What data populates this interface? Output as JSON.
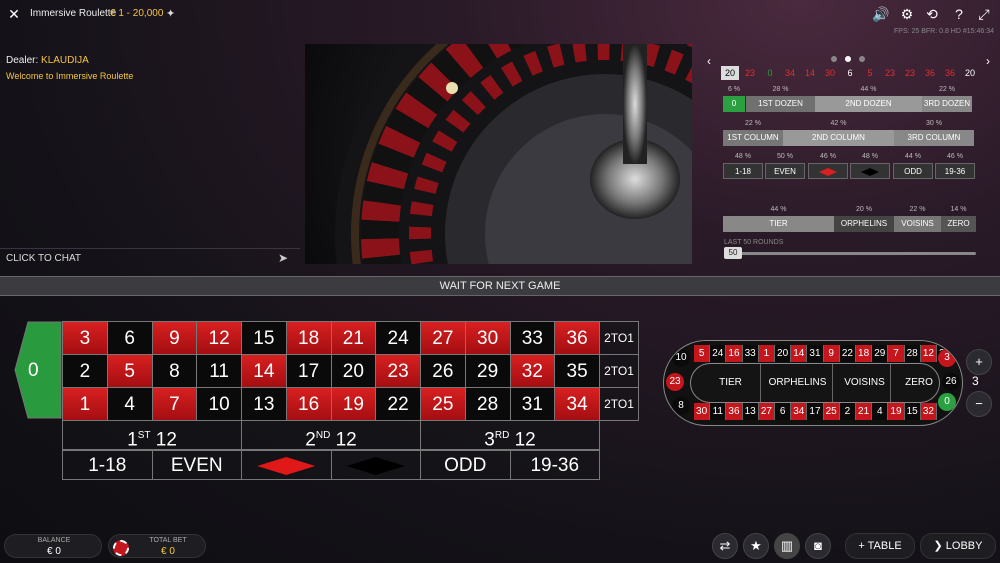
{
  "header": {
    "close_icon": "close-icon",
    "title": "Immersive Roulette",
    "limits": "€ 1 - 20,000",
    "pin_icon": "pin-icon",
    "icons": [
      "volume-icon",
      "gear-icon",
      "history-icon",
      "help-icon",
      "fullscreen-icon"
    ],
    "fps_text": "FPS: 25 BFR: 0.8   HD   #15:46:34"
  },
  "chat": {
    "dealer_label": "Dealer:",
    "dealer_name": "KLAUDIJA",
    "welcome": "Welcome to Immersive Roulette",
    "click_to_chat": "CLICK TO CHAT"
  },
  "stats": {
    "recent_numbers": [
      {
        "n": "20",
        "c": "#000000"
      },
      {
        "n": "23",
        "c": "#e03030"
      },
      {
        "n": "0",
        "c": "#2aa040"
      },
      {
        "n": "34",
        "c": "#e03030"
      },
      {
        "n": "14",
        "c": "#e03030"
      },
      {
        "n": "30",
        "c": "#e03030"
      },
      {
        "n": "6",
        "c": "#ffffff"
      },
      {
        "n": "5",
        "c": "#e03030"
      },
      {
        "n": "23",
        "c": "#e03030"
      },
      {
        "n": "23",
        "c": "#e03030"
      },
      {
        "n": "36",
        "c": "#e03030"
      },
      {
        "n": "36",
        "c": "#e03030"
      },
      {
        "n": "20",
        "c": "#ffffff"
      }
    ],
    "dozens": {
      "pcts": [
        "6 %",
        "28 %",
        "44 %",
        "22 %"
      ],
      "labels": [
        "0",
        "1ST DOZEN",
        "2ND DOZEN",
        "3RD DOZEN"
      ]
    },
    "columns": {
      "pcts": [
        "22 %",
        "42 %",
        "30 %"
      ],
      "labels": [
        "1ST COLUMN",
        "2ND COLUMN",
        "3RD COLUMN"
      ]
    },
    "simple": {
      "pcts": [
        "48 %",
        "50 %",
        "46 %",
        "48 %",
        "44 %",
        "46 %"
      ],
      "labels": [
        "1-18",
        "EVEN",
        "",
        "",
        "ODD",
        "19-36"
      ]
    },
    "sections": {
      "pcts": [
        "44 %",
        "20 %",
        "22 %",
        "14 %"
      ],
      "labels": [
        "TIER",
        "ORPHELINS",
        "VOISINS",
        "ZERO"
      ]
    },
    "last_rounds_label": "LAST 50 ROUNDS",
    "slider_value": "50"
  },
  "banner": "WAIT FOR NEXT GAME",
  "table": {
    "zero": "0",
    "rows": [
      [
        {
          "n": "3",
          "c": "red"
        },
        {
          "n": "6",
          "c": "black"
        },
        {
          "n": "9",
          "c": "red"
        },
        {
          "n": "12",
          "c": "red"
        },
        {
          "n": "15",
          "c": "black"
        },
        {
          "n": "18",
          "c": "red"
        },
        {
          "n": "21",
          "c": "red"
        },
        {
          "n": "24",
          "c": "black"
        },
        {
          "n": "27",
          "c": "red"
        },
        {
          "n": "30",
          "c": "red"
        },
        {
          "n": "33",
          "c": "black"
        },
        {
          "n": "36",
          "c": "red"
        }
      ],
      [
        {
          "n": "2",
          "c": "black"
        },
        {
          "n": "5",
          "c": "red"
        },
        {
          "n": "8",
          "c": "black"
        },
        {
          "n": "11",
          "c": "black"
        },
        {
          "n": "14",
          "c": "red"
        },
        {
          "n": "17",
          "c": "black"
        },
        {
          "n": "20",
          "c": "black"
        },
        {
          "n": "23",
          "c": "red"
        },
        {
          "n": "26",
          "c": "black"
        },
        {
          "n": "29",
          "c": "black"
        },
        {
          "n": "32",
          "c": "red"
        },
        {
          "n": "35",
          "c": "black"
        }
      ],
      [
        {
          "n": "1",
          "c": "red"
        },
        {
          "n": "4",
          "c": "black"
        },
        {
          "n": "7",
          "c": "red"
        },
        {
          "n": "10",
          "c": "black"
        },
        {
          "n": "13",
          "c": "black"
        },
        {
          "n": "16",
          "c": "red"
        },
        {
          "n": "19",
          "c": "red"
        },
        {
          "n": "22",
          "c": "black"
        },
        {
          "n": "25",
          "c": "red"
        },
        {
          "n": "28",
          "c": "black"
        },
        {
          "n": "31",
          "c": "black"
        },
        {
          "n": "34",
          "c": "red"
        }
      ]
    ],
    "column_bets": [
      "2TO1",
      "2TO1",
      "2TO1"
    ],
    "dozens": [
      {
        "num": "1",
        "sup": "ST",
        "txt": "12"
      },
      {
        "num": "2",
        "sup": "ND",
        "txt": "12"
      },
      {
        "num": "3",
        "sup": "RD",
        "txt": "12"
      }
    ],
    "outside": [
      "1-18",
      "EVEN",
      "",
      "",
      "ODD",
      "19-36"
    ]
  },
  "racetrack": {
    "top": [
      {
        "n": "5",
        "c": "red"
      },
      {
        "n": "24",
        "c": "black"
      },
      {
        "n": "16",
        "c": "red"
      },
      {
        "n": "33",
        "c": "black"
      },
      {
        "n": "1",
        "c": "red"
      },
      {
        "n": "20",
        "c": "black"
      },
      {
        "n": "14",
        "c": "red"
      },
      {
        "n": "31",
        "c": "black"
      },
      {
        "n": "9",
        "c": "red"
      },
      {
        "n": "22",
        "c": "black"
      },
      {
        "n": "18",
        "c": "red"
      },
      {
        "n": "29",
        "c": "black"
      },
      {
        "n": "7",
        "c": "red"
      },
      {
        "n": "28",
        "c": "black"
      },
      {
        "n": "12",
        "c": "red"
      },
      {
        "n": "35",
        "c": "black"
      }
    ],
    "bottom": [
      {
        "n": "30",
        "c": "red"
      },
      {
        "n": "11",
        "c": "black"
      },
      {
        "n": "36",
        "c": "red"
      },
      {
        "n": "13",
        "c": "black"
      },
      {
        "n": "27",
        "c": "red"
      },
      {
        "n": "6",
        "c": "black"
      },
      {
        "n": "34",
        "c": "red"
      },
      {
        "n": "17",
        "c": "black"
      },
      {
        "n": "25",
        "c": "red"
      },
      {
        "n": "2",
        "c": "black"
      },
      {
        "n": "21",
        "c": "red"
      },
      {
        "n": "4",
        "c": "black"
      },
      {
        "n": "19",
        "c": "red"
      },
      {
        "n": "15",
        "c": "black"
      },
      {
        "n": "32",
        "c": "red"
      }
    ],
    "left": [
      {
        "n": "10",
        "c": "black"
      },
      {
        "n": "23",
        "c": "red"
      },
      {
        "n": "8",
        "c": "black"
      }
    ],
    "right": [
      {
        "n": "3",
        "c": "red"
      },
      {
        "n": "26",
        "c": "black"
      },
      {
        "n": "0",
        "c": "green"
      }
    ],
    "sections": [
      "TIER",
      "ORPHELINS",
      "VOISINS",
      "ZERO"
    ],
    "neighbours": "3",
    "plus": "+",
    "minus": "−"
  },
  "footer": {
    "balance_label": "BALANCE",
    "balance_value": "€ 0",
    "total_bet_label": "TOTAL BET",
    "total_bet_value": "€ 0",
    "table_btn": "TABLE",
    "lobby_btn": "LOBBY",
    "icons": [
      "switch-view-icon",
      "favourite-star-icon",
      "statistics-icon",
      "camera-icon"
    ]
  },
  "colors": {
    "red": "#c4161c",
    "black": "#0a0a0a",
    "green": "#2aa040",
    "gold": "#f4c542"
  }
}
